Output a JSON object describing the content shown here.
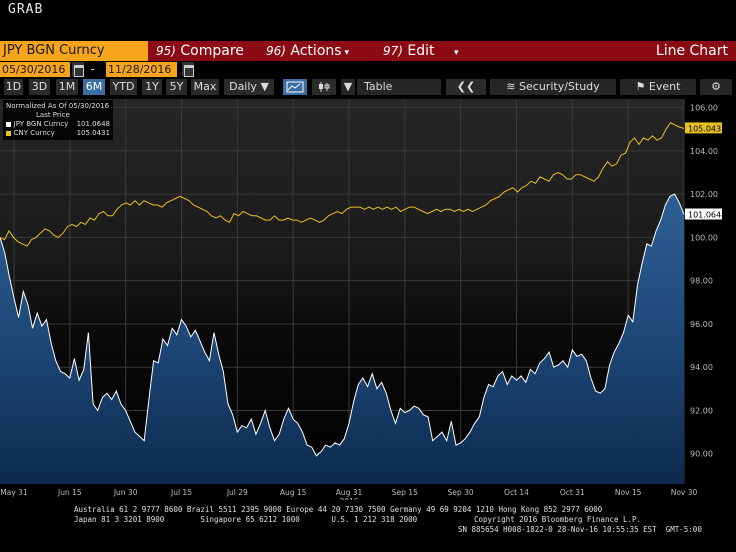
{
  "app": {
    "title": "GRAB"
  },
  "command_bar": {
    "security": "JPY BGN Curncy",
    "compare_num": "95)",
    "compare_label": "Compare",
    "actions_num": "96)",
    "actions_label": "Actions",
    "edit_num": "97)",
    "edit_label": "Edit",
    "view_title": "Line Chart"
  },
  "date_range": {
    "start": "05/30/2016",
    "end": "11/28/2016",
    "separator": "-"
  },
  "toolbar": {
    "periods": [
      "1D",
      "3D",
      "1M",
      "6M",
      "YTD",
      "1Y",
      "5Y",
      "Max"
    ],
    "active_period": "6M",
    "frequency": "Daily",
    "table_label": "Table",
    "security_study_label": "Security/Study",
    "event_label": "Event"
  },
  "legend": {
    "header1": "Normalized As Of 05/30/2016",
    "header2": "Last Price",
    "items": [
      {
        "name": "JPY BGN Curncy",
        "value": "101.0648",
        "color": "#ffffff"
      },
      {
        "name": "CNY Curncy",
        "value": "105.0431",
        "color": "#e8c020"
      }
    ]
  },
  "chart_data": {
    "type": "area",
    "title": "",
    "xlabel": "",
    "ylabel": "",
    "ylim": [
      88.6,
      106.4
    ],
    "yticks": [
      90,
      92,
      94,
      96,
      98,
      100,
      102,
      104,
      106
    ],
    "xtick_labels": [
      "May 31",
      "Jun 15",
      "Jun 30",
      "Jul 15",
      "Jul 29",
      "Aug 15",
      "Aug 31",
      "Sep 15",
      "Sep 30",
      "Oct 14",
      "Oct 31",
      "Nov 15",
      "Nov 30"
    ],
    "x_sublabel": {
      "under": "Aug 31",
      "text": "2016"
    },
    "grid": true,
    "last_value_labels": [
      "105.0431",
      "101.0648"
    ],
    "series": [
      {
        "name": "JPY BGN Curncy",
        "color": "#ffffff",
        "fill": "#1e4a78",
        "values": [
          100.0,
          99.3,
          98.2,
          97.2,
          96.3,
          97.5,
          96.9,
          95.8,
          96.5,
          95.9,
          96.2,
          95.1,
          94.3,
          93.8,
          93.7,
          93.5,
          94.4,
          93.4,
          93.9,
          95.6,
          92.3,
          92.0,
          92.6,
          92.8,
          92.5,
          92.9,
          92.3,
          92.0,
          91.5,
          91.0,
          90.8,
          90.6,
          92.5,
          94.3,
          94.2,
          95.3,
          95.0,
          95.8,
          95.5,
          96.2,
          95.9,
          95.4,
          95.7,
          95.2,
          94.7,
          94.3,
          95.6,
          94.6,
          93.8,
          92.3,
          91.8,
          91.0,
          91.3,
          91.2,
          91.6,
          90.9,
          91.4,
          92.0,
          91.2,
          90.6,
          90.9,
          91.6,
          92.1,
          91.6,
          91.4,
          91.0,
          90.4,
          90.3,
          89.9,
          90.1,
          90.4,
          90.3,
          90.5,
          90.4,
          90.7,
          91.4,
          92.4,
          93.2,
          93.5,
          93.1,
          93.7,
          93.0,
          93.3,
          92.8,
          92.0,
          91.4,
          92.1,
          91.9,
          92.0,
          92.2,
          92.1,
          91.8,
          91.7,
          90.6,
          90.8,
          91.0,
          90.6,
          91.5,
          90.4,
          90.5,
          90.7,
          91.0,
          91.4,
          91.7,
          92.6,
          93.2,
          93.1,
          93.6,
          93.8,
          93.2,
          93.6,
          93.4,
          93.6,
          93.3,
          93.9,
          93.7,
          94.2,
          94.4,
          94.7,
          94.0,
          94.1,
          94.3,
          94.0,
          94.8,
          94.5,
          94.6,
          94.3,
          93.5,
          92.9,
          92.8,
          93.0,
          94.1,
          94.7,
          95.1,
          95.6,
          96.4,
          96.1,
          97.8,
          98.8,
          99.7,
          99.6,
          100.3,
          100.8,
          101.5,
          101.9,
          102.0,
          101.6,
          101.06
        ]
      },
      {
        "name": "CNY Curncy",
        "color": "#e8c020",
        "values": [
          100.0,
          99.9,
          100.3,
          100.0,
          99.8,
          99.7,
          99.6,
          99.9,
          100.0,
          100.2,
          100.4,
          100.3,
          100.1,
          100.0,
          100.2,
          100.5,
          100.6,
          100.5,
          100.7,
          100.6,
          100.9,
          100.8,
          101.1,
          101.2,
          101.0,
          101.0,
          101.3,
          101.5,
          101.6,
          101.5,
          101.7,
          101.5,
          101.7,
          101.6,
          101.5,
          101.5,
          101.4,
          101.6,
          101.7,
          101.8,
          101.9,
          101.8,
          101.7,
          101.5,
          101.4,
          101.3,
          101.2,
          101.0,
          100.9,
          101.0,
          100.8,
          100.7,
          101.1,
          101.0,
          101.2,
          101.1,
          101.0,
          101.0,
          100.9,
          100.8,
          100.8,
          101.0,
          100.8,
          100.8,
          100.9,
          100.8,
          100.8,
          100.7,
          100.8,
          100.9,
          100.8,
          100.7,
          100.8,
          101.0,
          101.1,
          101.2,
          101.1,
          101.3,
          101.4,
          101.4,
          101.4,
          101.3,
          101.4,
          101.3,
          101.4,
          101.3,
          101.4,
          101.3,
          101.4,
          101.2,
          101.3,
          101.4,
          101.4,
          101.3,
          101.2,
          101.1,
          101.2,
          101.3,
          101.2,
          101.3,
          101.3,
          101.2,
          101.3,
          101.2,
          101.3,
          101.2,
          101.3,
          101.4,
          101.5,
          101.7,
          101.8,
          101.9,
          102.1,
          102.2,
          102.3,
          102.1,
          102.3,
          102.4,
          102.6,
          102.5,
          102.8,
          102.7,
          102.6,
          102.9,
          103.0,
          102.9,
          102.7,
          102.7,
          102.9,
          102.9,
          102.8,
          102.7,
          102.6,
          102.8,
          103.2,
          103.5,
          103.3,
          103.4,
          103.8,
          103.9,
          104.4,
          104.6,
          104.3,
          104.6,
          104.5,
          104.7,
          104.5,
          104.6,
          105.0,
          105.3,
          105.2,
          105.1,
          105.04
        ]
      }
    ]
  },
  "footer": {
    "line1": "Australia 61 2 9777 8600 Brazil 5511 2395 9000 Europe 44 20 7330 7500 Germany 49 69 9204 1210 Hong Kong 852 2977 6000",
    "line2a": "Japan 81 3 3201 8900        Singapore 65 6212 1000       U.S. 1 212 318 2000",
    "line2b": "Copyright 2016 Bloomberg Finance L.P.",
    "line3": "SN 885654 H008-1822-0 28-Nov-16 10:55:35 EST  GMT-5:00"
  }
}
